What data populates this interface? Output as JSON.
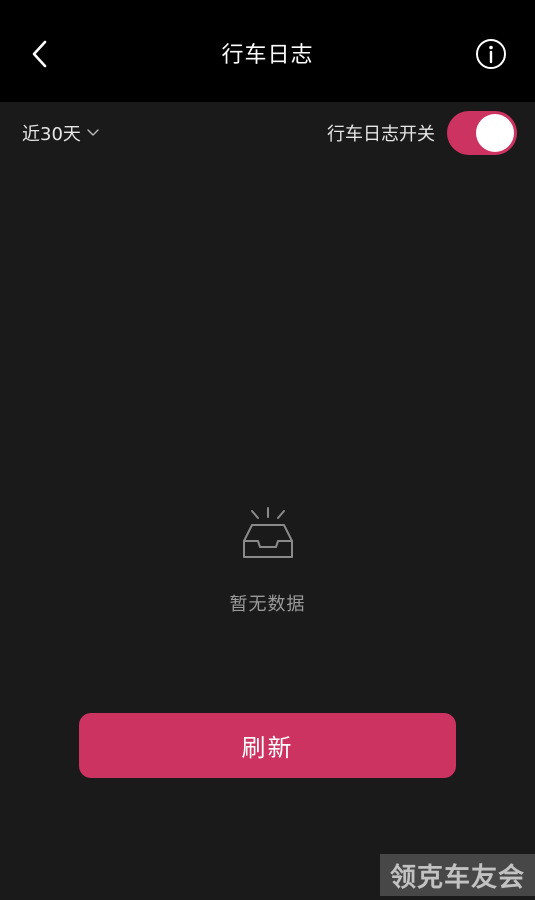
{
  "header": {
    "title": "行车日志",
    "back_icon": "chevron-left-icon",
    "info_icon": "info-circle-icon"
  },
  "filter": {
    "range_label": "近30天",
    "range_icon": "chevron-down-icon",
    "toggle_label": "行车日志开关",
    "toggle_on": true
  },
  "empty_state": {
    "icon": "empty-inbox-icon",
    "text": "暂无数据"
  },
  "refresh_button": {
    "label": "刷新"
  },
  "watermark": {
    "text": "领克车友会"
  },
  "colors": {
    "accent": "#cc3361",
    "background": "#1a1a1a",
    "header_bg": "#000000",
    "muted_text": "#9a9a9a"
  }
}
